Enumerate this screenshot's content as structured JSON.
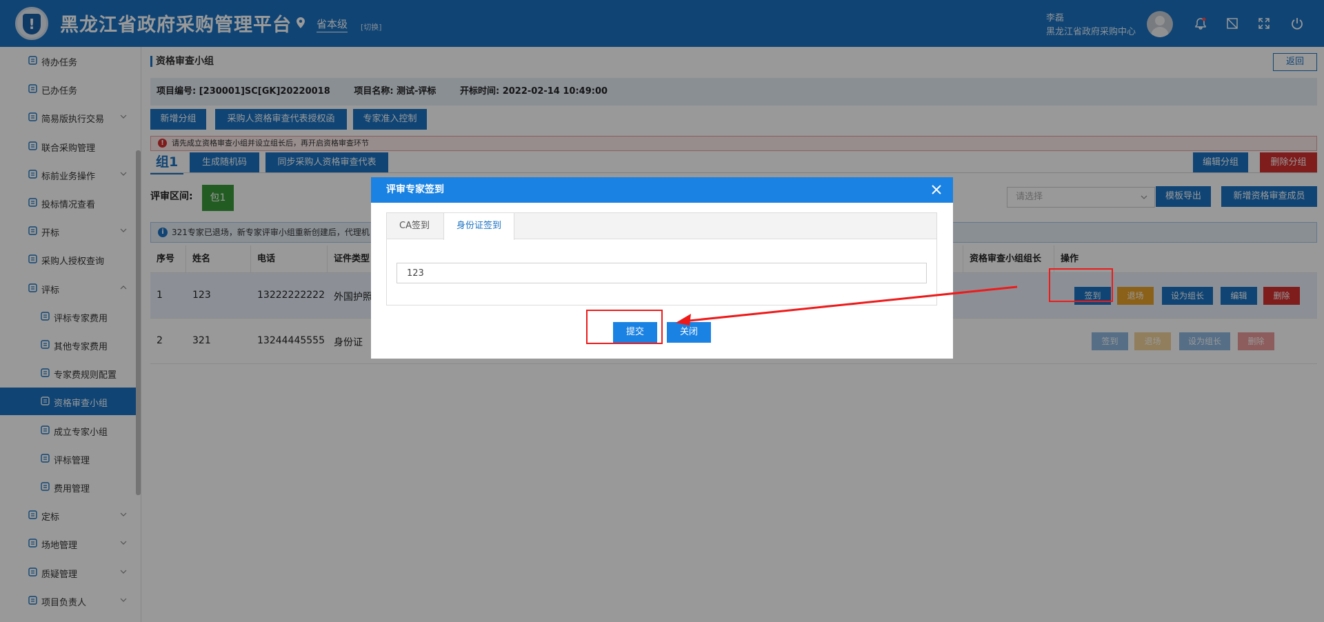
{
  "header": {
    "app_title": "黑龙江省政府采购管理平台",
    "level": "省本级",
    "switch_label": "[切换]",
    "user_name": "李磊",
    "user_org": "黑龙江省政府采购中心",
    "brand_color": "#1a72c2"
  },
  "sidebar": {
    "items": [
      {
        "label": "待办任务",
        "icon": "clipboard-clock-icon",
        "expandable": false
      },
      {
        "label": "已办任务",
        "icon": "clipboard-check-icon",
        "expandable": false
      },
      {
        "label": "简易版执行交易",
        "icon": "refresh-circle-icon",
        "expandable": true
      },
      {
        "label": "联合采购管理",
        "icon": "document-list-icon",
        "expandable": false
      },
      {
        "label": "标前业务操作",
        "icon": "cart-icon",
        "expandable": true
      },
      {
        "label": "投标情况查看",
        "icon": "chart-doc-icon",
        "expandable": false
      },
      {
        "label": "开标",
        "icon": "hammer-icon",
        "expandable": true
      },
      {
        "label": "采购人授权查询",
        "icon": "shield-search-icon",
        "expandable": false
      },
      {
        "label": "评标",
        "icon": "document-gavel-icon",
        "expandable": true
      },
      {
        "label": "评标专家费用",
        "icon": "yen-circle-icon",
        "expandable": false
      },
      {
        "label": "其他专家费用",
        "icon": "yen-circle-icon",
        "expandable": false
      },
      {
        "label": "专家费规则配置",
        "icon": "yen-circle-icon",
        "expandable": false
      },
      {
        "label": "资格审查小组",
        "icon": "user-group-icon",
        "expandable": false,
        "active": true
      },
      {
        "label": "成立专家小组",
        "icon": "user-add-icon",
        "expandable": false
      },
      {
        "label": "评标管理",
        "icon": "layers-icon",
        "expandable": false
      },
      {
        "label": "费用管理",
        "icon": "send-icon",
        "expandable": false
      },
      {
        "label": "定标",
        "icon": "chart-box-icon",
        "expandable": true
      },
      {
        "label": "场地管理",
        "icon": "user-location-icon",
        "expandable": true
      },
      {
        "label": "质疑管理",
        "icon": "cart-question-icon",
        "expandable": true
      },
      {
        "label": "项目负责人",
        "icon": "user-circle-icon",
        "expandable": true
      }
    ]
  },
  "main": {
    "page_title": "资格审查小组",
    "back_label": "返回",
    "info": {
      "project_no": "项目编号:  [230001]SC[GK]20220018",
      "project_name": "项目名称:  测试-评标",
      "open_time": "开标时间:  2022-02-14 10:49:00"
    },
    "toolbar": {
      "add_group": "新增分组",
      "authorize_letter": "采购人资格审查代表授权函",
      "expert_access": "专家准入控制"
    },
    "warning": "请先成立资格审查小组并设立组长后，再开启资格审查环节",
    "group": {
      "tab_label": "组1",
      "gen_code": "生成随机码",
      "sync_rep": "同步采购人资格审查代表",
      "edit_group": "编辑分组",
      "delete_group": "删除分组"
    },
    "review": {
      "label": "评审区间:",
      "package": "包1",
      "select_placeholder": "请选择",
      "export_template": "模板导出",
      "add_member": "新增资格审查成员"
    },
    "notice": "321专家已退场，新专家评审小组重新创建后，代理机",
    "table": {
      "headers": {
        "no": "序号",
        "name": "姓名",
        "phone": "电话",
        "id_type": "证件类型",
        "leader": "资格审查小组组长",
        "ops": "操作"
      },
      "rows": [
        {
          "no": "1",
          "name": "123",
          "phone": "13222222222",
          "id_type": "外国护照"
        },
        {
          "no": "2",
          "name": "321",
          "phone": "13244445555",
          "id_type": "身份证"
        }
      ],
      "actions": {
        "sign_in": "签到",
        "exit": "退场",
        "set_leader": "设为组长",
        "edit": "编辑",
        "delete": "删除"
      }
    }
  },
  "modal": {
    "title": "评审专家签到",
    "tabs": [
      "CA签到",
      "身份证签到"
    ],
    "active_tab": "身份证签到",
    "id_value": "123",
    "submit_label": "提交",
    "close_label": "关闭"
  },
  "colors": {
    "primary": "#1a72c2",
    "danger": "#d43030",
    "warning": "#e8a22a",
    "success": "#3a9a3a",
    "annotation": "#ee1a1a"
  }
}
